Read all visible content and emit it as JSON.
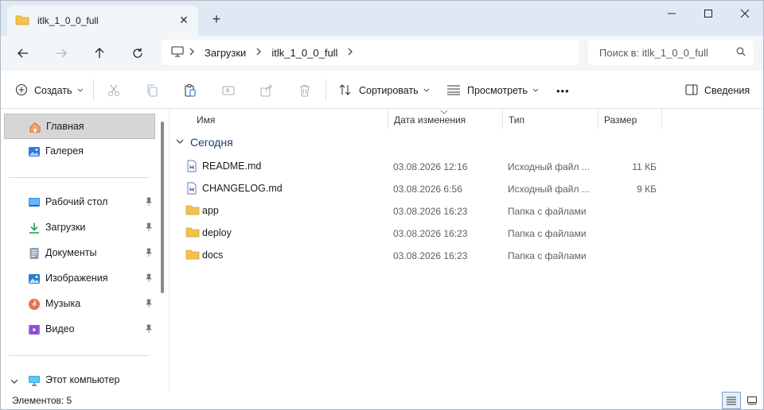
{
  "window": {
    "tab_title": "itlk_1_0_0_full",
    "tab_close": "✕",
    "new_tab": "+",
    "minimize": "—",
    "maximize": "☐",
    "close": "✕"
  },
  "address": {
    "crumbs": [
      "Загрузки",
      "itlk_1_0_0_full"
    ],
    "search_placeholder": "Поиск в: itlk_1_0_0_full"
  },
  "toolbar": {
    "create_label": "Создать",
    "sort_label": "Сортировать",
    "view_label": "Просмотреть",
    "more_label": "•••",
    "details_label": "Сведения"
  },
  "sidebar": {
    "items": [
      {
        "label": "Главная",
        "icon": "home-icon"
      },
      {
        "label": "Галерея",
        "icon": "gallery-icon"
      },
      {
        "label": "Рабочий стол",
        "icon": "desktop-icon"
      },
      {
        "label": "Загрузки",
        "icon": "download-icon"
      },
      {
        "label": "Документы",
        "icon": "documents-icon"
      },
      {
        "label": "Изображения",
        "icon": "pictures-icon"
      },
      {
        "label": "Музыка",
        "icon": "music-icon"
      },
      {
        "label": "Видео",
        "icon": "video-icon"
      },
      {
        "label": "Этот компьютер",
        "icon": "computer-icon"
      }
    ],
    "expand_chevron": "⌄"
  },
  "columns": {
    "name": "Имя",
    "date": "Дата изменения",
    "type": "Тип",
    "size": "Размер"
  },
  "group": {
    "label": "Сегодня"
  },
  "files": [
    {
      "name": "README.md",
      "date": "03.08.2026 12:16",
      "type": "Исходный файл ...",
      "size": "11 КБ",
      "kind": "file"
    },
    {
      "name": "CHANGELOG.md",
      "date": "03.08.2026 6:56",
      "type": "Исходный файл ...",
      "size": "9 КБ",
      "kind": "file"
    },
    {
      "name": "app",
      "date": "03.08.2026 16:23",
      "type": "Папка с файлами",
      "size": "",
      "kind": "folder"
    },
    {
      "name": "deploy",
      "date": "03.08.2026 16:23",
      "type": "Папка с файлами",
      "size": "",
      "kind": "folder"
    },
    {
      "name": "docs",
      "date": "03.08.2026 16:23",
      "type": "Папка с файлами",
      "size": "",
      "kind": "folder"
    }
  ],
  "status": {
    "count_text": "Элементов: 5"
  },
  "colors": {
    "accent": "#0067c0",
    "folder": "#f2c14e",
    "group_text": "#1f3a72"
  }
}
